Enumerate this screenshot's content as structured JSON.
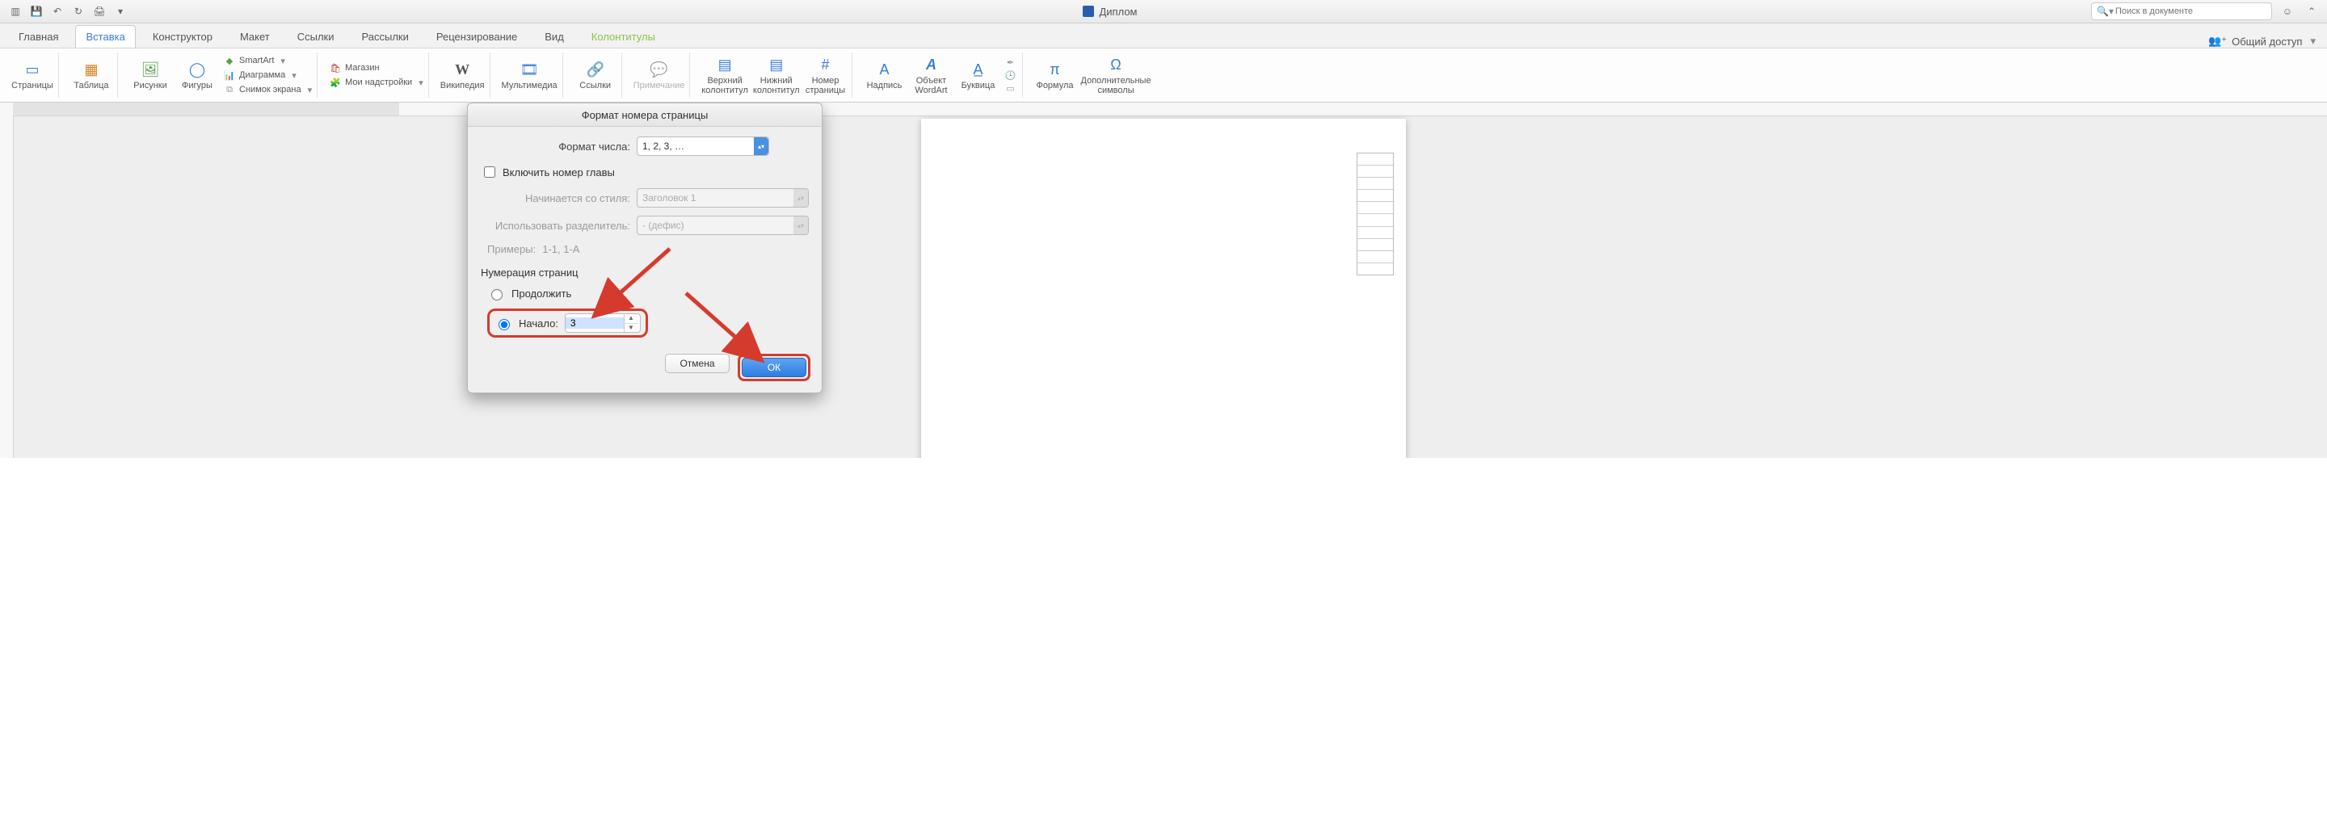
{
  "window": {
    "title": "Диплом"
  },
  "search": {
    "placeholder": "Поиск в документе"
  },
  "tabs": {
    "items": [
      "Главная",
      "Вставка",
      "Конструктор",
      "Макет",
      "Ссылки",
      "Рассылки",
      "Рецензирование",
      "Вид",
      "Колонтитулы"
    ],
    "active_index": 1,
    "contextual_index": 8,
    "share": "Общий доступ"
  },
  "ribbon": {
    "pages": "Страницы",
    "table": "Таблица",
    "pictures": "Рисунки",
    "shapes": "Фигуры",
    "smartart": "SmartArt",
    "chart": "Диаграмма",
    "screenshot": "Снимок экрана",
    "store": "Магазин",
    "myaddins": "Мои надстройки",
    "wikipedia": "Википедия",
    "media": "Мультимедиа",
    "links": "Ссылки",
    "comment": "Примечание",
    "header": "Верхний\nколонтитул",
    "footer": "Нижний\nколонтитул",
    "pageno": "Номер\nстраницы",
    "textbox": "Надпись",
    "wordart": "Объект\nWordArt",
    "dropcap": "Буквица",
    "equation": "Формула",
    "symbol": "Дополнительные\nсимволы"
  },
  "dialog": {
    "title": "Формат номера страницы",
    "number_format_label": "Формат числа:",
    "number_format_value": "1, 2, 3, …",
    "include_chapter": "Включить номер главы",
    "starts_with_style_label": "Начинается со стиля:",
    "starts_with_style_value": "Заголовок 1",
    "separator_label": "Использовать разделитель:",
    "separator_value": "-     (дефис)",
    "examples_label": "Примеры:",
    "examples_value": "1-1, 1-А",
    "page_numbering_section": "Нумерация страниц",
    "continue": "Продолжить",
    "start_at_label": "Начало:",
    "start_at_value": "3",
    "cancel": "Отмена",
    "ok": "ОК"
  }
}
